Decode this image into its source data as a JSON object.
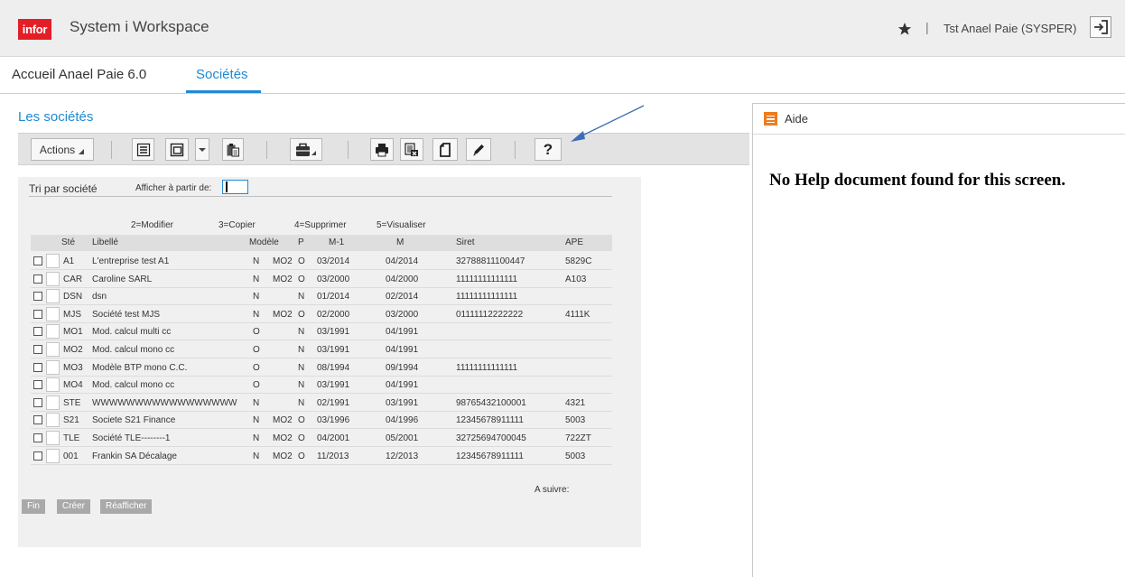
{
  "app": {
    "logo_text": "infor",
    "title": "System i Workspace",
    "user": "Tst Anael Paie (SYSPER)",
    "separator": "|",
    "accent": "#1f8ad4",
    "brand": "#e41e26"
  },
  "tabs": [
    {
      "label": "Accueil Anael Paie 6.0"
    },
    {
      "label": "Sociétés",
      "active": true
    }
  ],
  "page": {
    "title": "Les sociétés"
  },
  "toolbar": {
    "actions_label": "Actions",
    "help_label": "?",
    "icons": [
      "list-icon",
      "copy-icon",
      "dropdown-icon",
      "paste-icon",
      "briefcase-icon",
      "print-icon",
      "export-icon",
      "new-document-icon",
      "edit-icon",
      "help-icon"
    ]
  },
  "form": {
    "sort_label": "Tri par société",
    "from_label": "Afficher à partir de:",
    "from_value": ""
  },
  "options": [
    "2=Modifier",
    "3=Copier",
    "4=Supprimer",
    "5=Visualiser"
  ],
  "table": {
    "headers": [
      "Sté",
      "Libellé",
      "Modèle",
      "P",
      "M-1",
      "M",
      "Siret",
      "APE"
    ],
    "rows": [
      {
        "ste": "A1",
        "libelle": "L'entreprise test A1",
        "mod": "N",
        "mod2": "MO2",
        "p": "O",
        "m1": "03/2014",
        "m": "04/2014",
        "siret": "32788811100447",
        "ape": "5829C"
      },
      {
        "ste": "CAR",
        "libelle": "Caroline SARL",
        "mod": "N",
        "mod2": "MO2",
        "p": "O",
        "m1": "03/2000",
        "m": "04/2000",
        "siret": "11111111111111",
        "ape": "A103"
      },
      {
        "ste": "DSN",
        "libelle": "dsn",
        "mod": "N",
        "mod2": "",
        "p": "N",
        "m1": "01/2014",
        "m": "02/2014",
        "siret": "11111111111111",
        "ape": ""
      },
      {
        "ste": "MJS",
        "libelle": "Société test MJS",
        "mod": "N",
        "mod2": "MO2",
        "p": "O",
        "m1": "02/2000",
        "m": "03/2000",
        "siret": "01111112222222",
        "ape": "4111K"
      },
      {
        "ste": "MO1",
        "libelle": "Mod. calcul multi cc",
        "mod": "O",
        "mod2": "",
        "p": "N",
        "m1": "03/1991",
        "m": "04/1991",
        "siret": "",
        "ape": ""
      },
      {
        "ste": "MO2",
        "libelle": "Mod. calcul mono cc",
        "mod": "O",
        "mod2": "",
        "p": "N",
        "m1": "03/1991",
        "m": "04/1991",
        "siret": "",
        "ape": ""
      },
      {
        "ste": "MO3",
        "libelle": "Modèle BTP mono C.C.",
        "mod": "O",
        "mod2": "",
        "p": "N",
        "m1": "08/1994",
        "m": "09/1994",
        "siret": "11111111111111",
        "ape": ""
      },
      {
        "ste": "MO4",
        "libelle": "Mod. calcul mono cc",
        "mod": "O",
        "mod2": "",
        "p": "N",
        "m1": "03/1991",
        "m": "04/1991",
        "siret": "",
        "ape": ""
      },
      {
        "ste": "STE",
        "libelle": "WWWWWWWWWWWWWWWWW",
        "mod": "N",
        "mod2": "",
        "p": "N",
        "m1": "02/1991",
        "m": "03/1991",
        "siret": "98765432100001",
        "ape": "4321"
      },
      {
        "ste": "S21",
        "libelle": "Societe S21 Finance",
        "mod": "N",
        "mod2": "MO2",
        "p": "O",
        "m1": "03/1996",
        "m": "04/1996",
        "siret": "12345678911111",
        "ape": "5003"
      },
      {
        "ste": "TLE",
        "libelle": "Société TLE--------1",
        "mod": "N",
        "mod2": "MO2",
        "p": "O",
        "m1": "04/2001",
        "m": "05/2001",
        "siret": "32725694700045",
        "ape": "722ZT"
      },
      {
        "ste": "001",
        "libelle": "Frankin SA Décalage",
        "mod": "N",
        "mod2": "MO2",
        "p": "O",
        "m1": "11/2013",
        "m": "12/2013",
        "siret": "12345678911111",
        "ape": "5003"
      }
    ],
    "more_label": "A suivre:"
  },
  "function_keys": [
    "Fin",
    "Créer",
    "Réafficher"
  ],
  "help_panel": {
    "title": "Aide",
    "message": "No Help document found for this screen."
  }
}
